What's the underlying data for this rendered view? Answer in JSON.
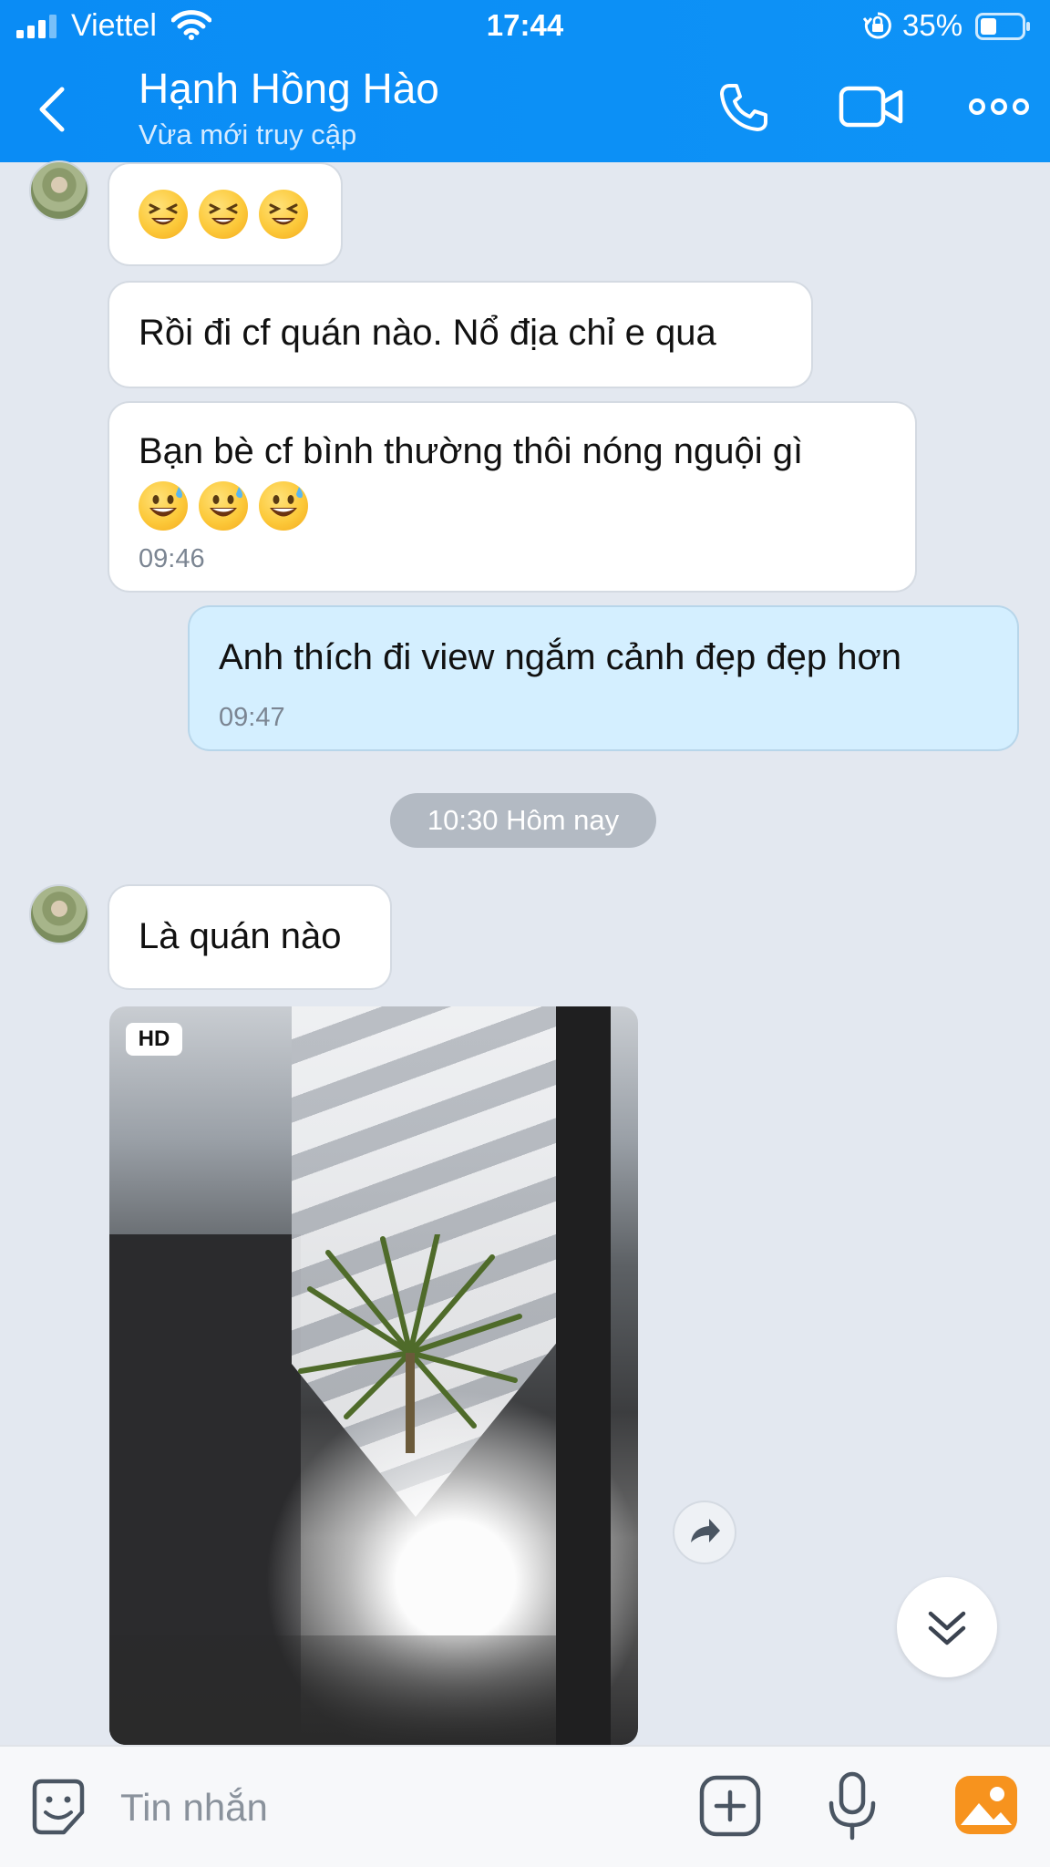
{
  "status_bar": {
    "carrier": "Viettel",
    "time": "17:44",
    "battery_percent": "35%"
  },
  "header": {
    "contact_name": "Hạnh Hồng Hào",
    "contact_status": "Vừa mới truy cập"
  },
  "messages": [
    {
      "sender": "contact",
      "emoji": [
        "laughing-face-emoji",
        "laughing-face-emoji",
        "laughing-face-emoji"
      ]
    },
    {
      "sender": "contact",
      "text": "Rồi đi cf quán nào. Nổ địa chỉ e qua"
    },
    {
      "sender": "contact",
      "text": "Bạn bè cf bình thường thôi nóng nguội gì",
      "emoji": [
        "grinning-sweat-emoji",
        "grinning-sweat-emoji",
        "grinning-sweat-emoji"
      ],
      "time": "09:46"
    },
    {
      "sender": "me",
      "text": "Anh thích đi view ngắm cảnh đẹp đẹp hơn",
      "time": "09:47"
    },
    {
      "date_separator": "10:30 Hôm nay"
    },
    {
      "sender": "contact",
      "text": "Là quán nào"
    },
    {
      "sender": "contact",
      "media": "video",
      "badge": "HD"
    }
  ],
  "composer": {
    "placeholder": "Tin nhắn"
  },
  "colors": {
    "header": "#0a8cf5",
    "chat_background": "#e3e8f0",
    "my_bubble": "#d4efff",
    "their_bubble": "#ffffff",
    "gallery_icon": "#f7931e"
  }
}
